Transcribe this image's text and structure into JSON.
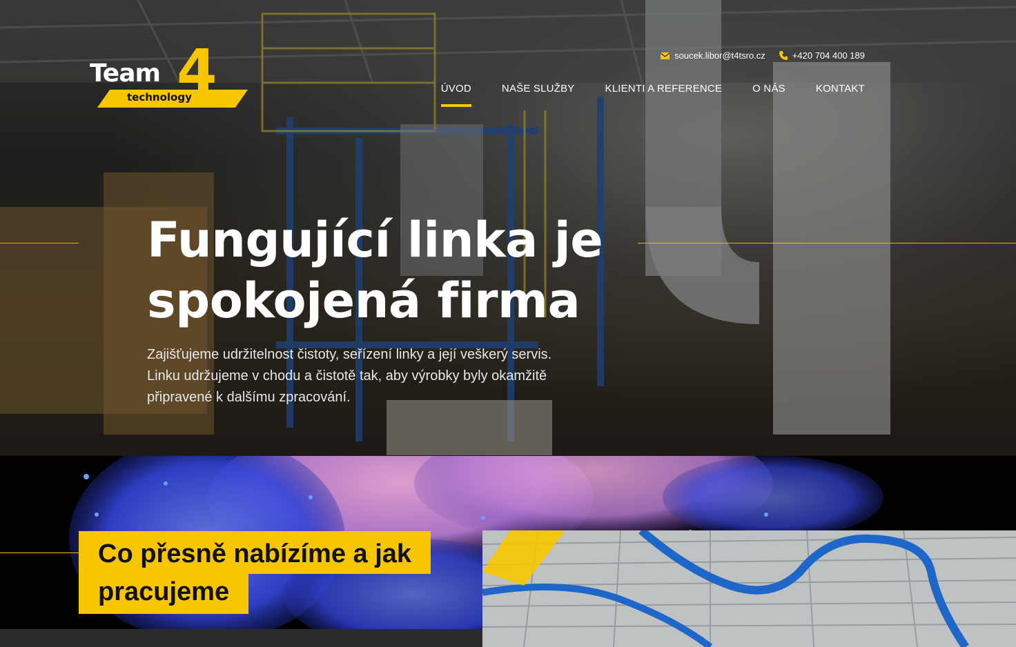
{
  "brand": {
    "logo_word": "Team",
    "logo_number": "4",
    "logo_subtitle": "technology",
    "accent": "#f7c600"
  },
  "contact": {
    "email": "soucek.libor@t4tsro.cz",
    "phone": "+420 704 400 189",
    "email_icon": "envelope-icon",
    "phone_icon": "phone-icon"
  },
  "nav": {
    "items": [
      {
        "label": "ÚVOD",
        "active": true
      },
      {
        "label": "NAŠE SLUŽBY",
        "active": false
      },
      {
        "label": "KLIENTI A REFERENCE",
        "active": false
      },
      {
        "label": "O NÁS",
        "active": false
      },
      {
        "label": "KONTAKT",
        "active": false
      }
    ]
  },
  "hero": {
    "headline_line1": "Fungující linka je",
    "headline_line2": "spokojená firma",
    "lead_line1": "Zajišťujeme udržitelnost čistoty, seřízení linky a její veškerý servis.",
    "lead_line2": "Linku udržujeme v chodu a čistotě tak, aby výrobky byly okamžitě",
    "lead_line3": "připravené k dalšímu zpracování."
  },
  "section2": {
    "title_line1": "Co přesně nabízíme a jak",
    "title_line2": "pracujeme"
  }
}
